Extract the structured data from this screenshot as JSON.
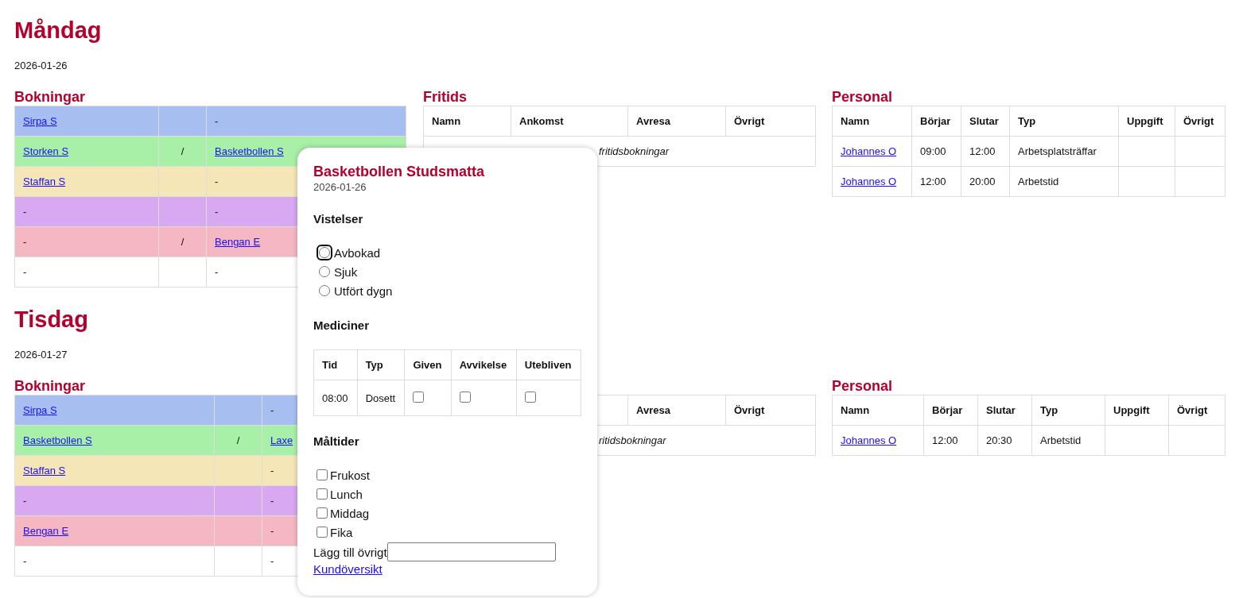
{
  "days": [
    {
      "title": "Måndag",
      "date": "2026-01-26",
      "bookings": {
        "title": "Bokningar",
        "rows": [
          {
            "color": "#a6bff0",
            "first": {
              "kind": "link",
              "text": "Sirpa S"
            },
            "partner": {
              "kind": "text",
              "text": "-"
            }
          },
          {
            "color": "#a8f0a8",
            "first": {
              "kind": "link",
              "text": "Storken S"
            },
            "separator": "/",
            "partner": {
              "kind": "link",
              "text": "Basketbollen S"
            }
          },
          {
            "color": "#f5e6b8",
            "first": {
              "kind": "link",
              "text": "Staffan S"
            },
            "partner": {
              "kind": "text",
              "text": "-"
            }
          },
          {
            "color": "#d8a8f0",
            "first": {
              "kind": "text",
              "text": "-"
            },
            "partner": {
              "kind": "text",
              "text": "-"
            }
          },
          {
            "color": "#f5b8c3",
            "first": {
              "kind": "text",
              "text": "-"
            },
            "separator": "/",
            "partner": {
              "kind": "link",
              "text": "Bengan E"
            }
          },
          {
            "color": "#ffffff",
            "first": {
              "kind": "text",
              "text": "-"
            },
            "partner": {
              "kind": "text",
              "text": "-"
            }
          }
        ]
      },
      "fritids": {
        "title": "Fritids",
        "columns": [
          "Namn",
          "Ankomst",
          "Avresa",
          "Övrigt"
        ],
        "note": "fritidsbokningar"
      },
      "personal": {
        "title": "Personal",
        "columns": [
          "Namn",
          "Börjar",
          "Slutar",
          "Typ",
          "Uppgift",
          "Övrigt"
        ],
        "rows": [
          {
            "name": "Johannes O",
            "start": "09:00",
            "end": "12:00",
            "type": "Arbetsplatsträffar"
          },
          {
            "name": "Johannes O",
            "start": "12:00",
            "end": "20:00",
            "type": "Arbetstid"
          }
        ]
      }
    },
    {
      "title": "Tisdag",
      "date": "2026-01-27",
      "bookings": {
        "title": "Bokningar",
        "rows": [
          {
            "color": "#a6bff0",
            "first": {
              "kind": "link",
              "text": "Sirpa S"
            },
            "partner": {
              "kind": "text",
              "text": "-"
            }
          },
          {
            "color": "#a8f0a8",
            "first": {
              "kind": "link",
              "text": "Basketbollen S"
            },
            "separator": "/",
            "partner": {
              "kind": "link",
              "text": "Laxe"
            }
          },
          {
            "color": "#f5e6b8",
            "first": {
              "kind": "link",
              "text": "Staffan S"
            },
            "partner": {
              "kind": "text",
              "text": "-"
            }
          },
          {
            "color": "#d8a8f0",
            "first": {
              "kind": "text",
              "text": "-"
            },
            "partner": {
              "kind": "text",
              "text": "-"
            }
          },
          {
            "color": "#f5b8c3",
            "first": {
              "kind": "link",
              "text": "Bengan E"
            },
            "partner": {
              "kind": "text",
              "text": "-"
            }
          },
          {
            "color": "#ffffff",
            "first": {
              "kind": "text",
              "text": "-"
            },
            "partner": {
              "kind": "text",
              "text": "-"
            }
          }
        ]
      },
      "fritids": {
        "columns": [
          "Avresa",
          "Övrigt"
        ],
        "note": "ritidsbokningar"
      },
      "personal": {
        "title": "Personal",
        "columns": [
          "Namn",
          "Börjar",
          "Slutar",
          "Typ",
          "Uppgift",
          "Övrigt"
        ],
        "rows": [
          {
            "name": "Johannes O",
            "start": "12:00",
            "end": "20:30",
            "type": "Arbetstid"
          }
        ]
      }
    }
  ],
  "popup": {
    "title": "Basketbollen Studsmatta",
    "date": "2026-01-26",
    "stays": {
      "title": "Vistelser",
      "options": [
        {
          "label": "Avbokad",
          "selected": false,
          "focused": true
        },
        {
          "label": "Sjuk",
          "selected": false,
          "focused": false
        },
        {
          "label": "Utfört dygn",
          "selected": false,
          "focused": false
        }
      ]
    },
    "medicines": {
      "title": "Mediciner",
      "columns": [
        "Tid",
        "Typ",
        "Given",
        "Avvikelse",
        "Utebliven"
      ],
      "rows": [
        {
          "time": "08:00",
          "type": "Dosett",
          "checks": [
            {
              "checked": false
            },
            {
              "checked": false
            },
            {
              "checked": false
            }
          ]
        }
      ]
    },
    "meals": {
      "title": "Måltider",
      "options": [
        {
          "label": "Frukost",
          "checked": false
        },
        {
          "label": "Lunch",
          "checked": false
        },
        {
          "label": "Middag",
          "checked": false
        },
        {
          "label": "Fika",
          "checked": false
        }
      ]
    },
    "other_label": "Lägg till övrigt",
    "link": "Kundöversikt"
  }
}
